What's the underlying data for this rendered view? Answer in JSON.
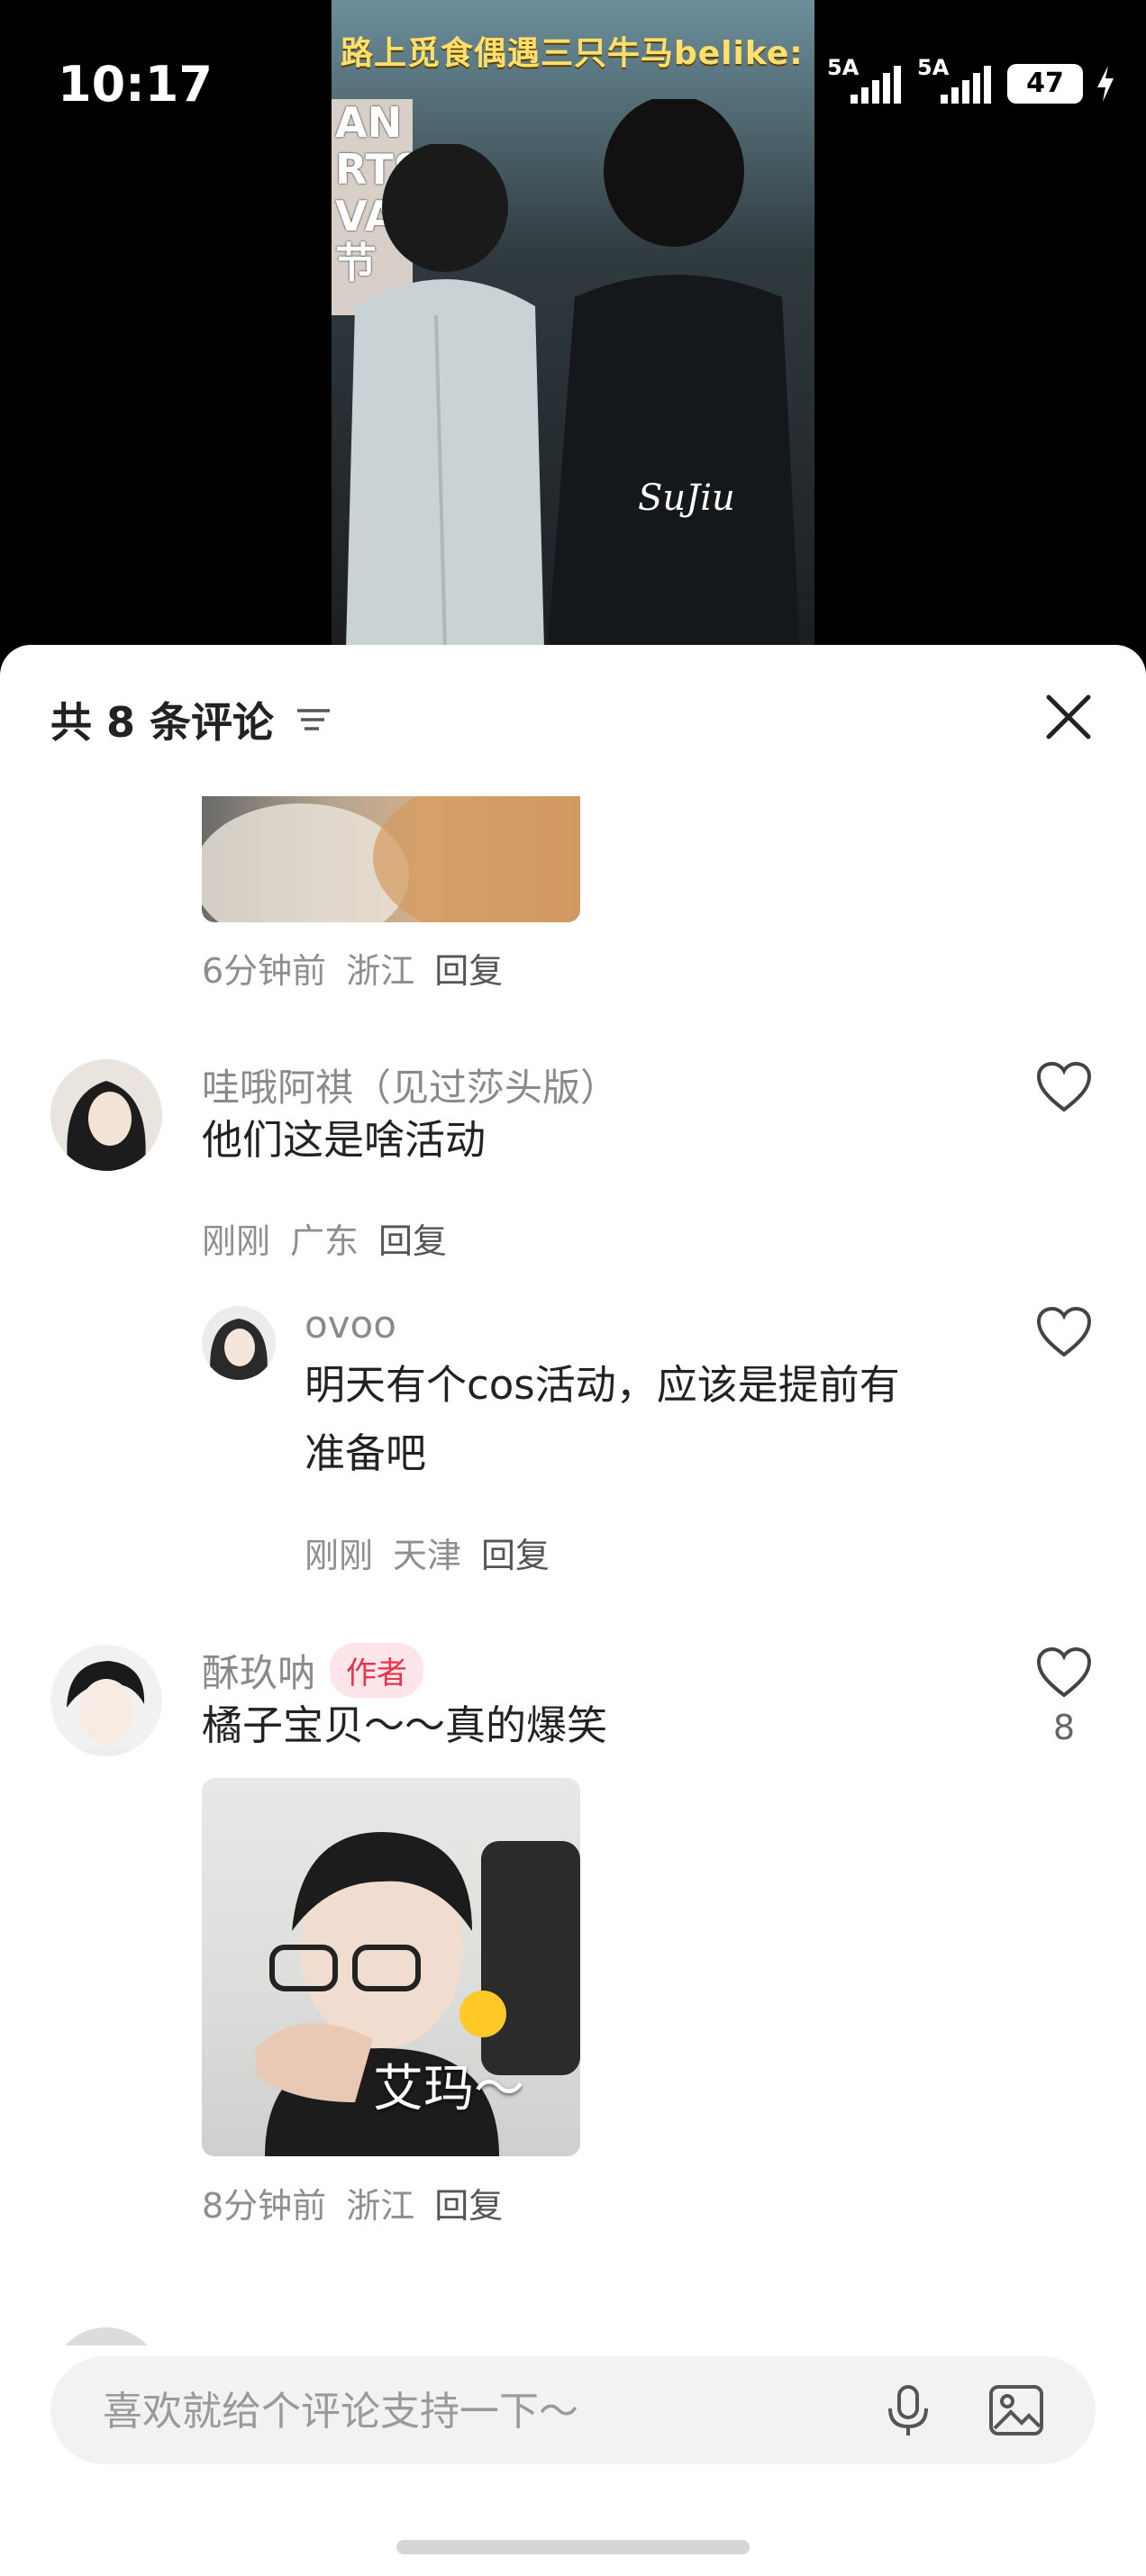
{
  "status_bar": {
    "time": "10:17",
    "signal1": "5A",
    "signal2": "5A",
    "battery": "47"
  },
  "video": {
    "banner_text": "路上觅食偶遇三只牛马belike:",
    "sign_text": [
      "AN",
      "RTS",
      "VAL",
      "节"
    ],
    "watermark": "SuJiu"
  },
  "comments_sheet": {
    "title": "共 8 条评论",
    "comments": [
      {
        "meta_time": "6分钟前",
        "meta_region": "浙江",
        "reply_label": "回复"
      },
      {
        "username": "哇哦阿祺（见过莎头版）",
        "text": "他们这是啥活动",
        "meta_time": "刚刚",
        "meta_region": "广东",
        "reply_label": "回复",
        "reply": {
          "username": "ovoo",
          "text_line1": "明天有个cos活动，应该是提前有",
          "text_line2": "准备吧",
          "meta_time": "刚刚",
          "meta_region": "天津",
          "reply_label": "回复"
        }
      },
      {
        "username": "酥玖呐",
        "badge": "作者",
        "text": "橘子宝贝～～真的爆笑",
        "likes": "8",
        "image_caption": "艾玛～",
        "meta_time": "8分钟前",
        "meta_region": "浙江",
        "reply_label": "回复"
      }
    ]
  },
  "input": {
    "placeholder": "喜欢就给个评论支持一下～"
  },
  "colors": {
    "accent_red": "#e8334a",
    "banner_yellow": "#ffe06a",
    "muted_text": "#8e8e8e"
  }
}
